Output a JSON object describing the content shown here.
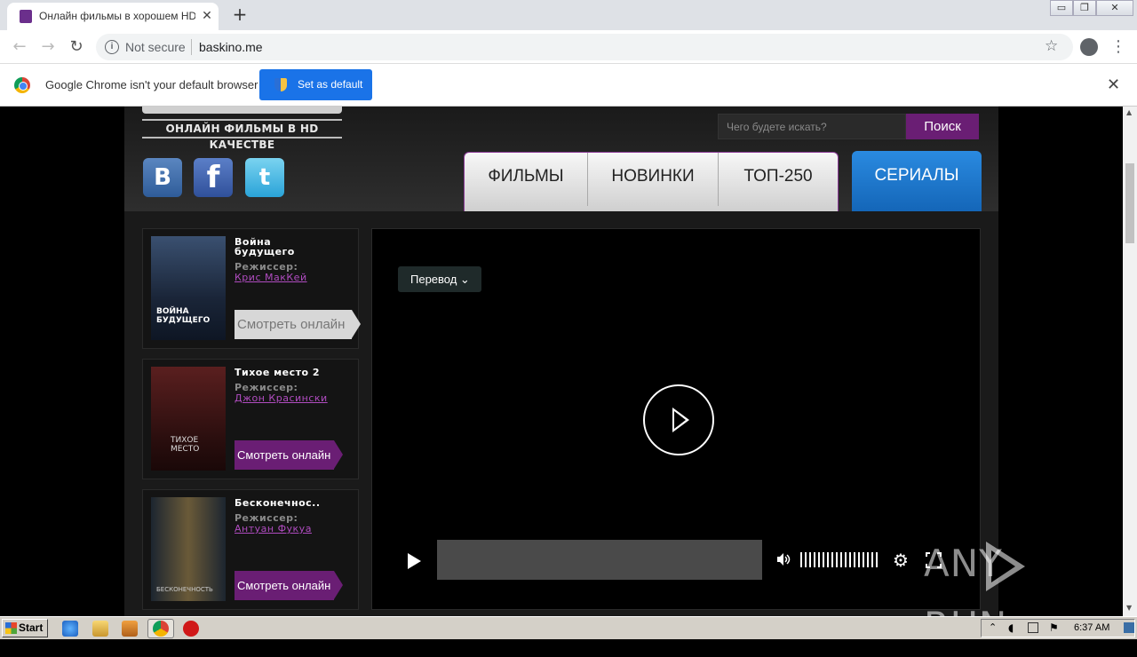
{
  "browser": {
    "tab_title": "Онлайн фильмы в хорошем HD кач",
    "tab_close": "✕",
    "new_tab": "+",
    "window_buttons": [
      "▭",
      "❐",
      "✕"
    ],
    "nav": {
      "back": "←",
      "forward": "→",
      "reload": "↻"
    },
    "security_label": "Not secure",
    "info_glyph": "i",
    "url": "baskino.me",
    "bookmark_star": "☆",
    "menu": "⋮"
  },
  "infobar": {
    "message": "Google Chrome isn't your default browser",
    "button": "Set as default",
    "close": "✕"
  },
  "site": {
    "logo_subtitle": "ОНЛАЙН ФИЛЬМЫ В HD КАЧЕСТВЕ",
    "social": {
      "vk": "B",
      "facebook": "f",
      "twitter": "t"
    },
    "search": {
      "placeholder": "Чего будете искать?",
      "button": "Поиск"
    },
    "nav": [
      "ФИЛЬМЫ",
      "НОВИНКИ",
      "ТОП-250"
    ],
    "nav_serials": "СЕРИАЛЫ",
    "director_label": "Режиссер:",
    "movies": [
      {
        "title": "Война будущего",
        "director": "Крис МакКей",
        "watch": "Смотреть онлайн",
        "poster_text": "ВОЙНА БУДУЩЕГО"
      },
      {
        "title": "Тихое место 2",
        "director": "Джон Красински",
        "watch": "Смотреть онлайн",
        "poster_text": "ТИХОЕ МЕСТО"
      },
      {
        "title": "Бесконечнос..",
        "director": "Антуан Фукуа",
        "watch": "Смотреть онлайн",
        "poster_text": "БЕСКОНЕЧНОСТЬ"
      }
    ],
    "player": {
      "translation": "Перевод ⌄",
      "gear": "⚙"
    }
  },
  "watermark": "ANY RUN",
  "taskbar": {
    "start": "Start",
    "clock": "6:37 AM"
  },
  "colors": {
    "accent_purple": "#6a1e74",
    "link_purple": "#b04cc0",
    "serials_blue": "#1a73d0",
    "chrome_blue": "#1a73e8"
  }
}
